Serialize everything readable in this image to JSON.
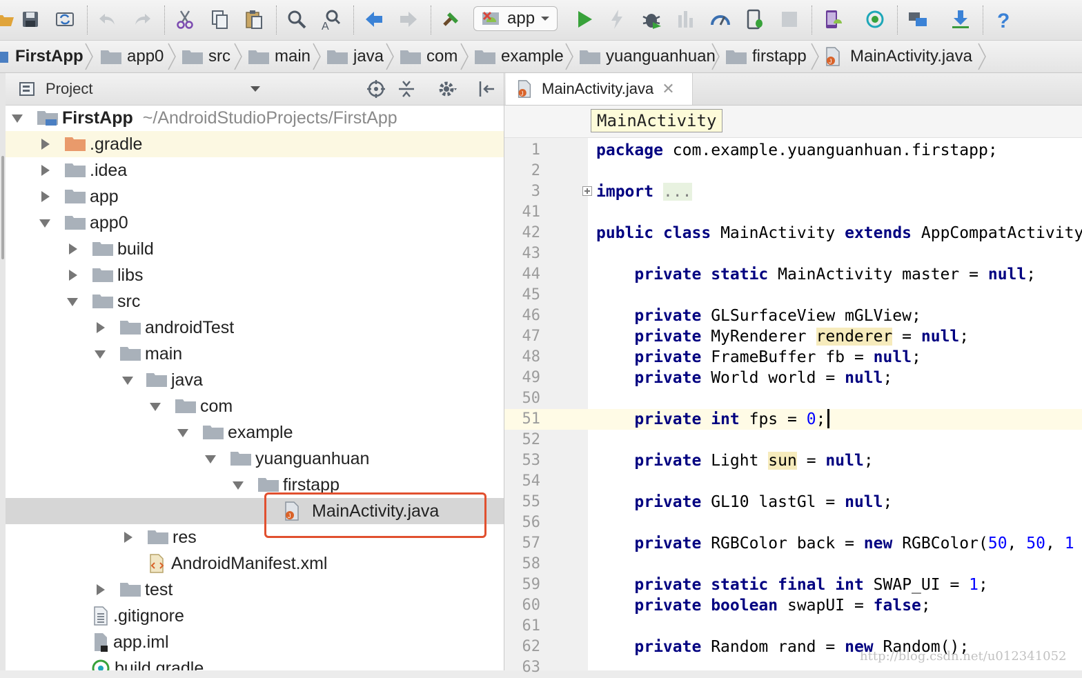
{
  "toolbar": {
    "run_config_label": "app",
    "icons": [
      "save-all-icon",
      "sync-icon",
      "undo-icon",
      "redo-icon",
      "cut-icon",
      "copy-icon",
      "paste-icon",
      "find-icon",
      "replace-icon",
      "back-icon",
      "forward-icon",
      "make-project-icon",
      "run-icon",
      "apply-changes-icon",
      "debug-icon",
      "coverage-icon",
      "profile-icon",
      "attach-debugger-icon",
      "stop-icon",
      "avd-manager-icon",
      "sync-gradle-icon",
      "project-structure-icon",
      "sdk-manager-icon",
      "help-icon"
    ]
  },
  "breadcrumb": [
    "FirstApp",
    "app0",
    "src",
    "main",
    "java",
    "com",
    "example",
    "yuanguanhuan",
    "firstapp",
    "MainActivity.java"
  ],
  "project": {
    "view_label": "Project",
    "tree": [
      {
        "label": "FirstApp",
        "path": "~/AndroidStudioProjects/FirstApp",
        "expanded": true,
        "icon": "module"
      },
      {
        "label": ".gradle",
        "expanded": false,
        "icon": "folder-orange"
      },
      {
        "label": ".idea",
        "expanded": false,
        "icon": "folder"
      },
      {
        "label": "app",
        "expanded": false,
        "icon": "folder"
      },
      {
        "label": "app0",
        "expanded": true,
        "icon": "folder"
      },
      {
        "label": "build",
        "expanded": false,
        "icon": "folder"
      },
      {
        "label": "libs",
        "expanded": false,
        "icon": "folder"
      },
      {
        "label": "src",
        "expanded": true,
        "icon": "folder"
      },
      {
        "label": "androidTest",
        "expanded": false,
        "icon": "folder"
      },
      {
        "label": "main",
        "expanded": true,
        "icon": "folder"
      },
      {
        "label": "java",
        "expanded": true,
        "icon": "folder"
      },
      {
        "label": "com",
        "expanded": true,
        "icon": "folder"
      },
      {
        "label": "example",
        "expanded": true,
        "icon": "folder"
      },
      {
        "label": "yuanguanhuan",
        "expanded": true,
        "icon": "folder"
      },
      {
        "label": "firstapp",
        "expanded": true,
        "icon": "folder"
      },
      {
        "label": "MainActivity.java",
        "icon": "java-file"
      },
      {
        "label": "res",
        "expanded": false,
        "icon": "folder"
      },
      {
        "label": "AndroidManifest.xml",
        "icon": "xml-file"
      },
      {
        "label": "test",
        "expanded": false,
        "icon": "folder"
      },
      {
        "label": ".gitignore",
        "icon": "text-file"
      },
      {
        "label": "app.iml",
        "icon": "iml-file"
      },
      {
        "label": "build.gradle",
        "icon": "gradle-file"
      }
    ]
  },
  "editor": {
    "tab_label": "MainActivity.java",
    "class_crumb": "MainActivity",
    "current_line": "51",
    "lines": [
      {
        "n": "1",
        "code": "package com.example.yuanguanhuan.firstapp;"
      },
      {
        "n": "2",
        "code": ""
      },
      {
        "n": "3",
        "code": "import ..."
      },
      {
        "n": "41",
        "code": ""
      },
      {
        "n": "42",
        "code": "public class MainActivity extends AppCompatActivity"
      },
      {
        "n": "43",
        "code": ""
      },
      {
        "n": "44",
        "code": "    private static MainActivity master = null;"
      },
      {
        "n": "45",
        "code": ""
      },
      {
        "n": "46",
        "code": "    private GLSurfaceView mGLView;"
      },
      {
        "n": "47",
        "code": "    private MyRenderer renderer = null;"
      },
      {
        "n": "48",
        "code": "    private FrameBuffer fb = null;"
      },
      {
        "n": "49",
        "code": "    private World world = null;"
      },
      {
        "n": "50",
        "code": ""
      },
      {
        "n": "51",
        "code": "    private int fps = 0;"
      },
      {
        "n": "52",
        "code": ""
      },
      {
        "n": "53",
        "code": "    private Light sun = null;"
      },
      {
        "n": "54",
        "code": ""
      },
      {
        "n": "55",
        "code": "    private GL10 lastGl = null;"
      },
      {
        "n": "56",
        "code": ""
      },
      {
        "n": "57",
        "code": "    private RGBColor back = new RGBColor(50, 50, 1"
      },
      {
        "n": "58",
        "code": ""
      },
      {
        "n": "59",
        "code": "    private static final int SWAP_UI = 1;"
      },
      {
        "n": "60",
        "code": "    private boolean swapUI = false;"
      },
      {
        "n": "61",
        "code": ""
      },
      {
        "n": "62",
        "code": "    private Random rand = new Random();"
      },
      {
        "n": "63",
        "code": ""
      }
    ]
  },
  "watermark": "http://blog.csdn.net/u012341052",
  "colors": {
    "keyword": "#000080",
    "number": "#0000ff",
    "highlight": "#f6ebbc",
    "annotation": "#e1502f",
    "current_line": "#fffbe6"
  }
}
